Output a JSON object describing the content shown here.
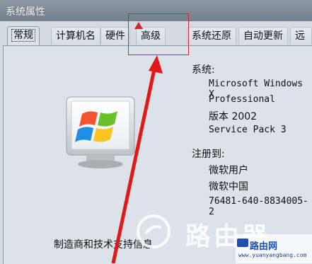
{
  "window": {
    "title": "系统属性"
  },
  "tabs": [
    "常规",
    "计算机名",
    "硬件",
    "高级",
    "系统还原",
    "自动更新",
    "远程"
  ],
  "system": {
    "label": "系统:",
    "os_line1": "Microsoft Windows X",
    "os_line2": "Professional",
    "version": "版本 2002",
    "service_pack": "Service Pack 3"
  },
  "registered": {
    "label": "注册到:",
    "user": "微软用户",
    "org": "微软中国",
    "product_id": "76481-640-8834005-2"
  },
  "manufacturer_text": "制造商和技术支持信息",
  "watermark": {
    "text": "路由器",
    "site_name": "路由网",
    "url": "www.yuanyangbang.com"
  },
  "colors": {
    "highlight": "#d02a2a",
    "arrow": "#e01818"
  }
}
